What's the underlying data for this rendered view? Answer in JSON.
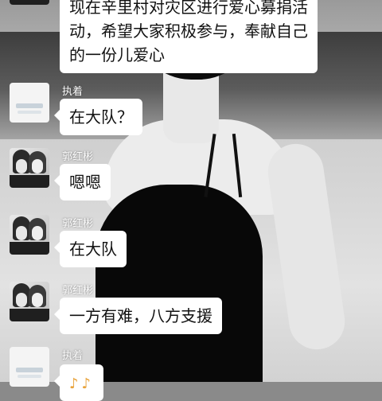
{
  "chat": {
    "top_message": {
      "lines": [
        "现在辛里村对灾区进行爱心募捐活",
        "动，希望大家积极参与，奉献自己",
        "的一份儿爱心"
      ]
    },
    "messages": [
      {
        "sender": "执着",
        "text": "在大队？",
        "avatar": "logo-avatar"
      },
      {
        "sender": "郭红彬",
        "text": "嗯嗯",
        "avatar": "photo-avatar"
      },
      {
        "sender": "郭红彬",
        "text": "在大队",
        "avatar": "photo-avatar"
      },
      {
        "sender": "郭红彬",
        "text": "一方有难，八方支援",
        "avatar": "photo-avatar"
      },
      {
        "sender": "执着",
        "text": "♪♪",
        "avatar": "logo-avatar"
      }
    ]
  }
}
